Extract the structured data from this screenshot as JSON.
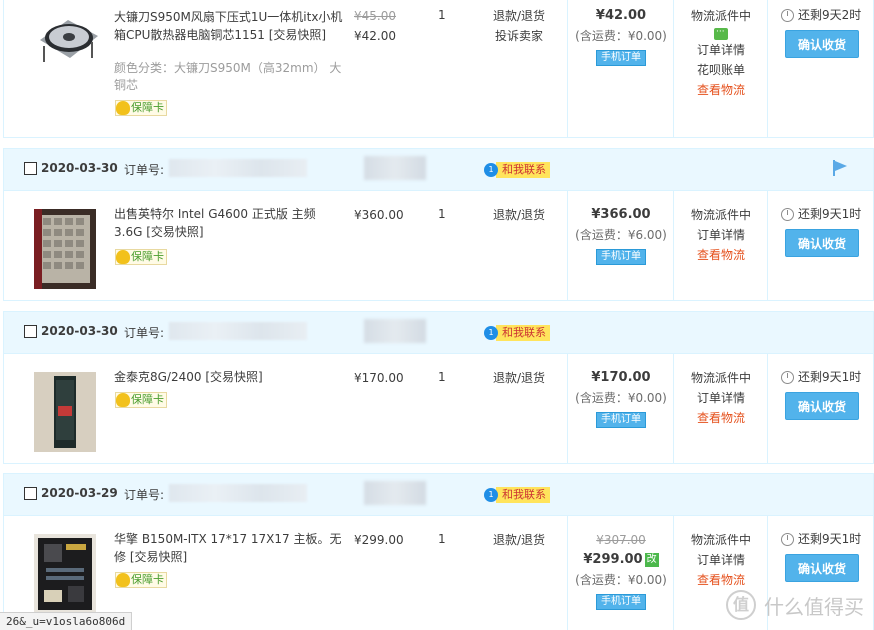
{
  "common": {
    "order_no_label": "订单号:",
    "contact_label": "和我联系",
    "guarantee_label": "保障卡",
    "refund_label": "退款/退货",
    "mobile_order_label": "手机订单",
    "order_detail_label": "订单详情",
    "logistics_label": "查看物流",
    "confirm_label": "确认收货",
    "status_label": "物流派件中"
  },
  "orders": [
    {
      "date": "",
      "title": "大镰刀S950M风扇下压式1U一体机itx小机箱CPU散热器电脑铜芯1151 [交易快照]",
      "sku": "颜色分类：大镰刀S950M（高32mm） 大铜芯",
      "orig_price": "¥45.00",
      "price": "¥42.00",
      "qty": "1",
      "complain_label": "投诉卖家",
      "total": "¥42.00",
      "total_orig": "",
      "shipping": "(含运费：¥0.00)",
      "huabei_label": "花呗账单",
      "remain": "还剩9天2时"
    },
    {
      "date": "2020-03-30",
      "title": "出售英特尔 Intel G4600 正式版 主频3.6G [交易快照]",
      "sku": "",
      "orig_price": "",
      "price": "¥360.00",
      "qty": "1",
      "total": "¥366.00",
      "total_orig": "",
      "shipping": "(含运费：¥6.00)",
      "remain": "还剩9天1时"
    },
    {
      "date": "2020-03-30",
      "title": "金泰克8G/2400 [交易快照]",
      "sku": "",
      "orig_price": "",
      "price": "¥170.00",
      "qty": "1",
      "total": "¥170.00",
      "total_orig": "",
      "shipping": "(含运费：¥0.00)",
      "remain": "还剩9天1时"
    },
    {
      "date": "2020-03-29",
      "title": "华擎 B150M-ITX 17*17 17X17 主板。无修 [交易快照]",
      "sku": "",
      "orig_price": "",
      "price": "¥299.00",
      "qty": "1",
      "total": "¥299.00",
      "total_orig": "¥307.00",
      "modified_label": "改",
      "shipping": "(含运费：¥0.00)",
      "remain": "还剩9天1时"
    }
  ],
  "status_url": "26&_u=v1osla6o806d",
  "watermark": {
    "logo_text": "值",
    "text": "什么值得买"
  },
  "colors": {
    "accent": "#52b3eb",
    "header_bg": "#eaf8ff",
    "logistics": "#e5511d",
    "guarantee_green": "#4a9d2e"
  }
}
